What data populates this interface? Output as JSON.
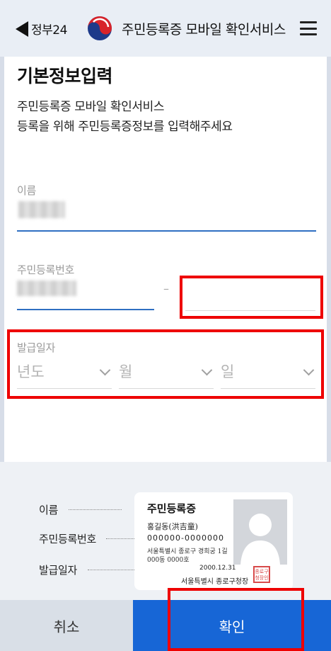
{
  "header": {
    "back_label": "정부24",
    "app_title": "주민등록증 모바일 확인서비스"
  },
  "page": {
    "title": "기본정보입력",
    "desc_line1": "주민등록증 모바일 확인서비스",
    "desc_line2": "등록을 위해 주민등록증정보를 입력해주세요"
  },
  "form": {
    "name_label": "이름",
    "rrn_label": "주민등록번호",
    "rrn_separator": "–",
    "issue_date_label": "발급일자",
    "year_placeholder": "년도",
    "month_placeholder": "월",
    "day_placeholder": "일"
  },
  "example": {
    "label_name": "이름",
    "label_rrn": "주민등록번호",
    "label_issue_date": "발급일자",
    "card_title": "주민등록증",
    "card_name": "홍길동(洪吉童)",
    "card_rrn": "000000-0000000",
    "card_address_line1": "서울특별시 종로구 경희궁 1길",
    "card_address_line2": "000동 0000호",
    "card_date": "2000.12.31",
    "card_issuer": "서울특별시 종로구청장",
    "seal_text": "종로구 청장인"
  },
  "buttons": {
    "cancel": "취소",
    "confirm": "확인"
  },
  "colors": {
    "header_bg": "#e9eef5",
    "accent_blue": "#1766d6",
    "highlight_red": "#ee0000"
  },
  "icons": {
    "back": "back-arrow-icon",
    "emblem": "taegeuk-emblem-icon",
    "menu": "hamburger-menu-icon",
    "chevron": "chevron-down-icon"
  }
}
